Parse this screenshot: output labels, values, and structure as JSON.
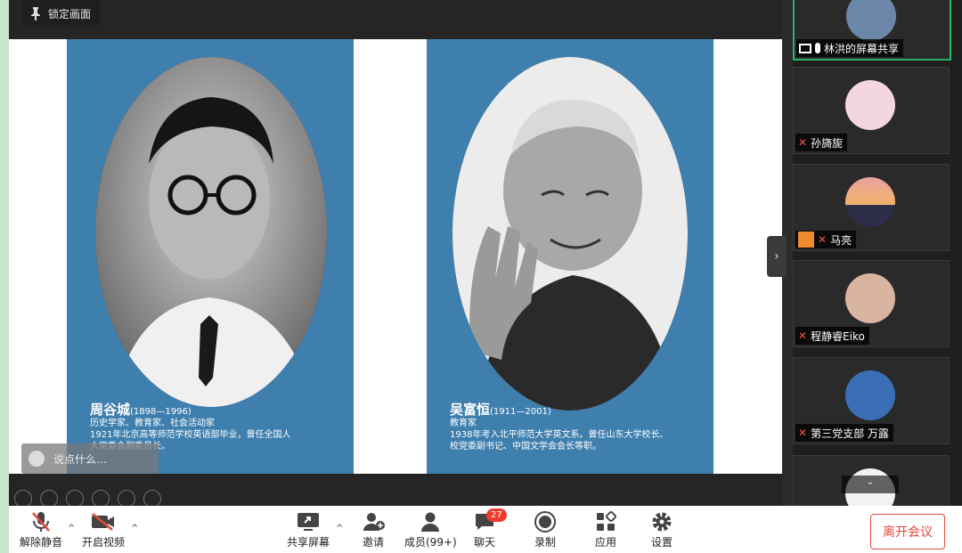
{
  "top": {
    "lock_label": "锁定画面"
  },
  "slide": {
    "left": {
      "name": "周谷城",
      "years": "(1898—1996)",
      "line1": "历史学家、教育家、社会活动家",
      "line2": "1921年北京高等师范学校英语部毕业，曾任全国人",
      "line3": "大常委会副委员长。"
    },
    "right": {
      "name": "吴富恒",
      "years": "(1911—2001)",
      "line1": "教育家",
      "line2": "1938年考入北平师范大学英文系。曾任山东大学校长、",
      "line3": "校党委副书记、中国文学会会长等职。"
    }
  },
  "chat_input": {
    "placeholder": "说点什么…"
  },
  "participants": [
    {
      "name": "林洪的屏幕共享",
      "state": "sharing"
    },
    {
      "name": "孙旖旎",
      "state": "muted"
    },
    {
      "name": "马亮",
      "state": "muted"
    },
    {
      "name": "程静睿Eiko",
      "state": "muted"
    },
    {
      "name": "第三党支部 万露",
      "state": "muted"
    }
  ],
  "toolbar": {
    "unmute": "解除静音",
    "start_video": "开启视频",
    "share_screen": "共享屏幕",
    "invite": "邀请",
    "members": "成员(99+)",
    "chat": "聊天",
    "chat_badge": "27",
    "record": "录制",
    "apps": "应用",
    "settings": "设置",
    "leave": "离开会议"
  },
  "colors": {
    "panel": "#3f7fae",
    "leave": "#e24a3a",
    "badge": "#f03a2e",
    "active": "#29b16a"
  }
}
